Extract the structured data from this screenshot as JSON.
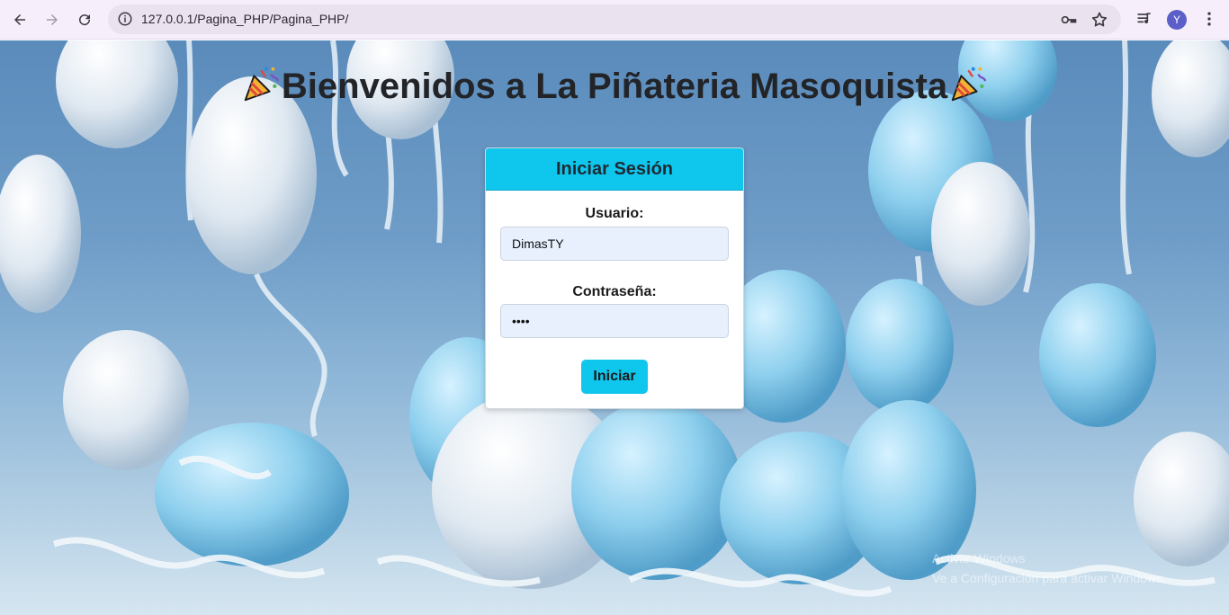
{
  "browser": {
    "url": "127.0.0.1/Pagina_PHP/Pagina_PHP/",
    "profile_initial": "Y"
  },
  "page": {
    "title": "Bienvenidos a La Piñateria Masoquista"
  },
  "login": {
    "header": "Iniciar Sesión",
    "username_label": "Usuario:",
    "username_value": "DimasTY",
    "password_label": "Contraseña:",
    "password_value": "••••",
    "submit_label": "Iniciar"
  },
  "watermark": {
    "line1": "Activar Windows",
    "line2": "Ve a Configuración para activar Windows."
  },
  "colors": {
    "accent": "#0fc6ec",
    "toolbar": "#f6eefa",
    "omnibox": "#ebe2f0",
    "input_bg": "#e8f0fe"
  },
  "icons": [
    "back-arrow-icon",
    "forward-arrow-icon",
    "reload-icon",
    "site-info-icon",
    "password-key-icon",
    "bookmark-star-icon",
    "media-queue-icon",
    "profile-avatar",
    "kebab-menu-icon",
    "party-popper-icon"
  ]
}
